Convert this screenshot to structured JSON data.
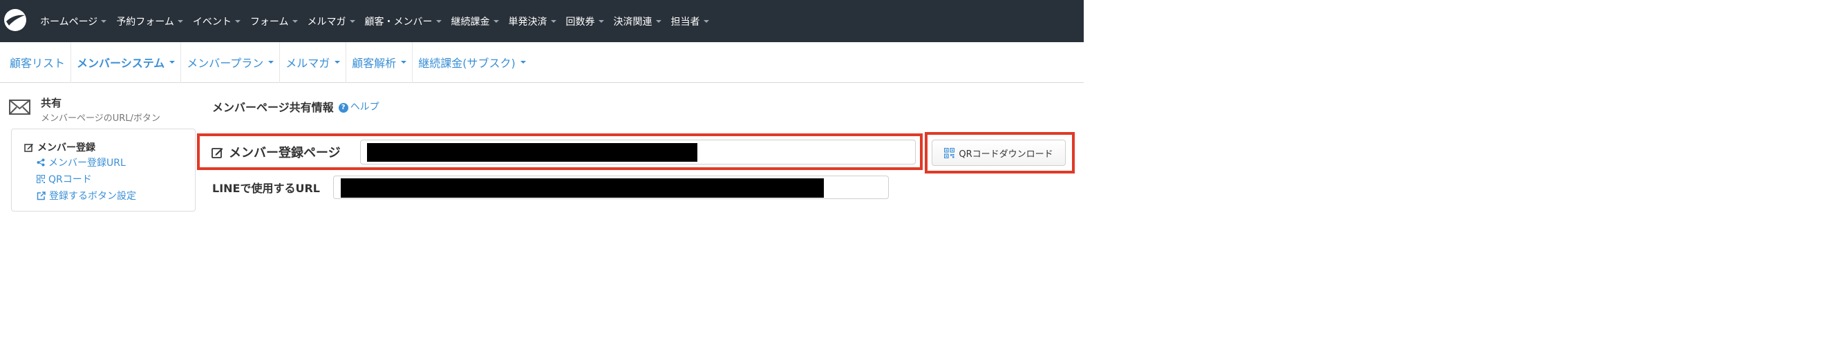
{
  "topnav": {
    "items": [
      {
        "label": "ホームページ"
      },
      {
        "label": "予約フォーム"
      },
      {
        "label": "イベント"
      },
      {
        "label": "フォーム"
      },
      {
        "label": "メルマガ"
      },
      {
        "label": "顧客・メンバー"
      },
      {
        "label": "継続課金"
      },
      {
        "label": "単発決済"
      },
      {
        "label": "回数券"
      },
      {
        "label": "決済関連"
      },
      {
        "label": "担当者"
      }
    ]
  },
  "subnav": {
    "items": [
      {
        "label": "顧客リスト"
      },
      {
        "label": "メンバーシステム"
      },
      {
        "label": "メンバープラン"
      },
      {
        "label": "メルマガ"
      },
      {
        "label": "顧客解析"
      },
      {
        "label": "継続課金(サブスク)"
      }
    ]
  },
  "sidebar": {
    "title": "共有",
    "subtitle": "メンバーページのURL/ボタン",
    "group_label": "メンバー登録",
    "links": [
      {
        "label": "メンバー登録URL",
        "icon": "share-icon"
      },
      {
        "label": "QRコード",
        "icon": "qr-icon"
      },
      {
        "label": "登録するボタン設定",
        "icon": "external-link-icon"
      }
    ]
  },
  "main": {
    "section_title": "メンバーページ共有情報",
    "help_label": "ヘルプ",
    "register_label": "メンバー登録ページ",
    "line_label": "LINEで使用するURL",
    "qr_button_label": "QRコードダウンロード"
  },
  "colors": {
    "topbar": "#283039",
    "accent": "#3a8fd6",
    "highlight": "#e03a27"
  }
}
